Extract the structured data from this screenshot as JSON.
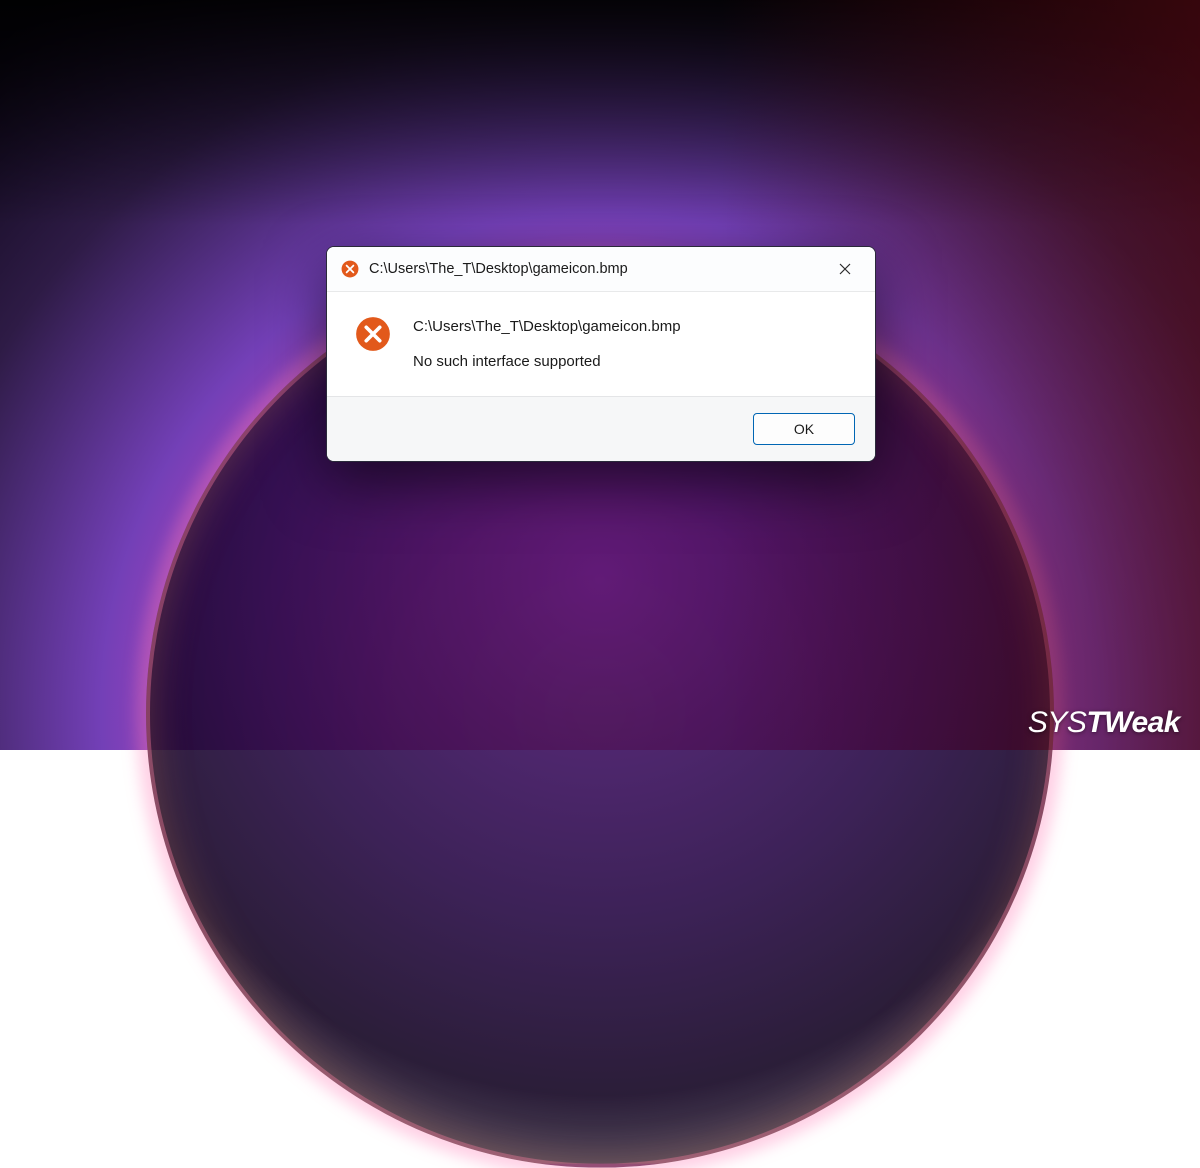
{
  "dialog": {
    "title": "C:\\Users\\The_T\\Desktop\\gameicon.bmp",
    "body_path": "C:\\Users\\The_T\\Desktop\\gameicon.bmp",
    "body_message": "No such interface supported",
    "ok_label": "OK"
  },
  "watermark": {
    "prefix": "SYS",
    "suffix": "TWeak"
  },
  "colors": {
    "error_icon": "#e2591b",
    "ok_border": "#0066b4"
  }
}
